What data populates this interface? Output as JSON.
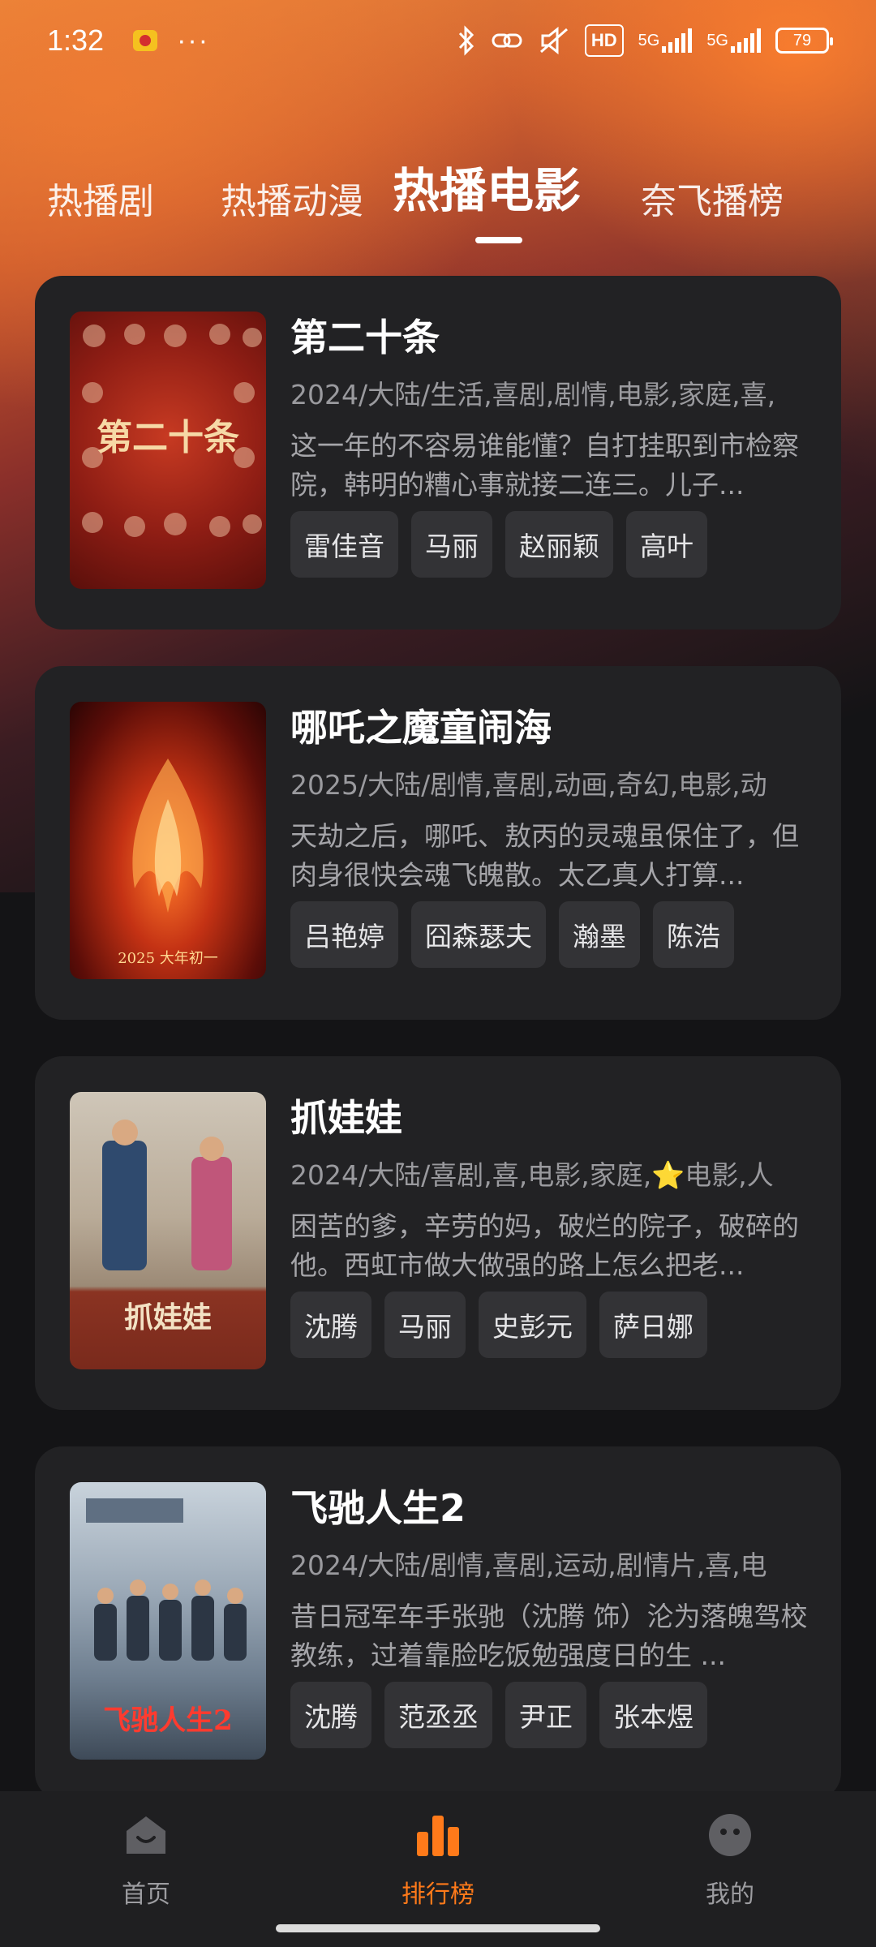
{
  "status": {
    "time": "1:32",
    "more": "···",
    "hd": "HD",
    "net1": "5G",
    "net2": "5G",
    "battery": "79"
  },
  "tabs": [
    {
      "label": "热播剧",
      "active": false
    },
    {
      "label": "热播动漫",
      "active": false
    },
    {
      "label": "热播电影",
      "active": true
    },
    {
      "label": "奈飞播榜",
      "active": false
    }
  ],
  "movies": [
    {
      "title": "第二十条",
      "meta": "2024/大陆/生活,喜剧,剧情,电影,家庭,喜,",
      "desc": "这一年的不容易谁能懂？自打挂职到市检察院，韩明的糟心事就接二连三。儿子...",
      "cast": [
        "雷佳音",
        "马丽",
        "赵丽颖",
        "高叶"
      ],
      "poster_text": "第二十条"
    },
    {
      "title": "哪吒之魔童闹海",
      "meta": "2025/大陆/剧情,喜剧,动画,奇幻,电影,动",
      "desc": "天劫之后，哪吒、敖丙的灵魂虽保住了，但肉身很快会魂飞魄散。太乙真人打算...",
      "cast": [
        "吕艳婷",
        "囧森瑟夫",
        "瀚墨",
        "陈浩"
      ],
      "poster_text": "2025 大年初一"
    },
    {
      "title": "抓娃娃",
      "meta": "2024/大陆/喜剧,喜,电影,家庭,⭐电影,人",
      "desc": "困苦的爹，辛劳的妈，破烂的院子，破碎的他。西虹市做大做强的路上怎么把老...",
      "cast": [
        "沈腾",
        "马丽",
        "史彭元",
        "萨日娜"
      ],
      "poster_text": "抓娃娃"
    },
    {
      "title": "飞驰人生2",
      "meta": "2024/大陆/剧情,喜剧,运动,剧情片,喜,电",
      "desc": "昔日冠军车手张驰（沈腾 饰）沦为落魄驾校教练，过着靠脸吃饭勉强度日的生 ...",
      "cast": [
        "沈腾",
        "范丞丞",
        "尹正",
        "张本煜"
      ],
      "poster_text": "飞驰人生2"
    }
  ],
  "nav": [
    {
      "label": "首页",
      "icon": "home-icon",
      "active": false
    },
    {
      "label": "排行榜",
      "icon": "ranking-icon",
      "active": true
    },
    {
      "label": "我的",
      "icon": "profile-icon",
      "active": false
    }
  ],
  "colors": {
    "accent": "#ff7a1a",
    "card": "#222224",
    "tag": "#333336"
  }
}
